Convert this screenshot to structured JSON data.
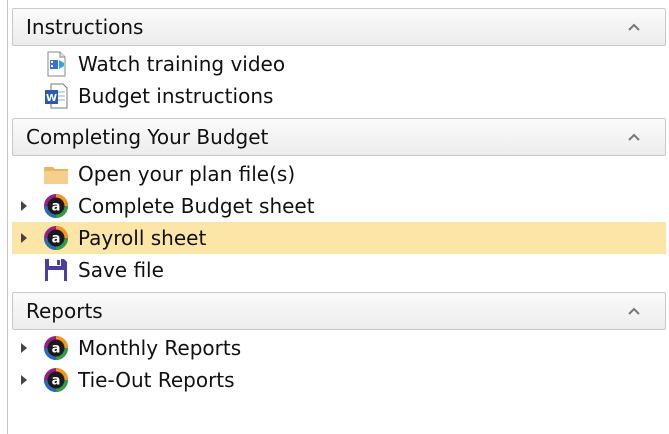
{
  "sections": [
    {
      "title": "Instructions",
      "items": [
        {
          "label": "Watch training video",
          "icon": "media-file-icon"
        },
        {
          "label": "Budget instructions",
          "icon": "word-document-icon"
        }
      ]
    },
    {
      "title": "Completing Your Budget",
      "items": [
        {
          "label": "Open your plan file(s)",
          "icon": "folder-icon"
        },
        {
          "label": "Complete Budget sheet",
          "icon": "app-logo-icon",
          "expandable": true
        },
        {
          "label": "Payroll sheet",
          "icon": "app-logo-icon",
          "expandable": true,
          "selected": true
        },
        {
          "label": "Save file",
          "icon": "floppy-disk-icon"
        }
      ]
    },
    {
      "title": "Reports",
      "items": [
        {
          "label": "Monthly Reports",
          "icon": "app-logo-icon",
          "expandable": true
        },
        {
          "label": "Tie-Out Reports",
          "icon": "app-logo-icon",
          "expandable": true
        }
      ]
    }
  ],
  "colors": {
    "selected_row": "#fbe6a8",
    "header_border": "#c9c9c9",
    "floppy": "#4b3e9e",
    "folder": "#f1c27d"
  }
}
